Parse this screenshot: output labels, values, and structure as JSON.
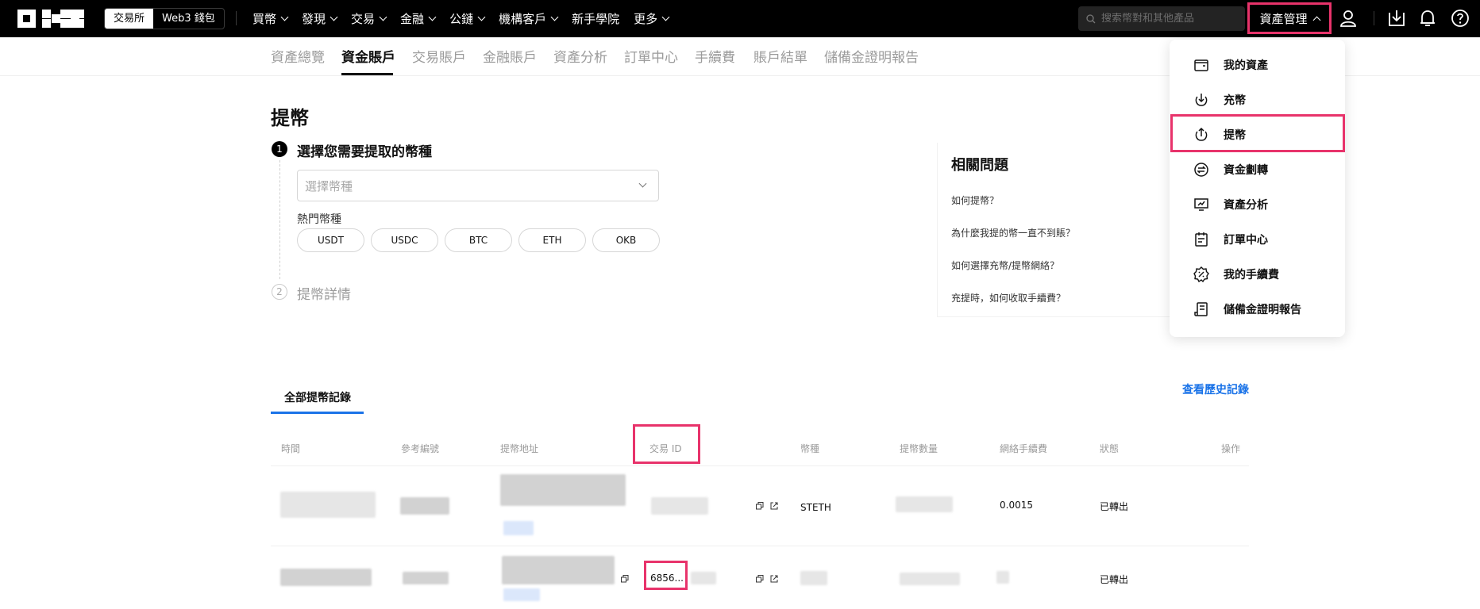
{
  "topnav": {
    "segments": [
      "交易所",
      "Web3 錢包"
    ],
    "menu": [
      "買幣",
      "發現",
      "交易",
      "金融",
      "公鏈",
      "機構客戶",
      "新手學院",
      "更多"
    ],
    "menu_has_chevron": [
      true,
      true,
      true,
      true,
      true,
      true,
      false,
      true
    ],
    "search_placeholder": "搜索幣對和其他產品",
    "asset_button": "資產管理",
    "icons": [
      "user-icon",
      "download-icon",
      "bell-icon",
      "help-icon"
    ]
  },
  "subnav": {
    "tabs": [
      "資產總覽",
      "資金賬戶",
      "交易賬戶",
      "金融賬戶",
      "資產分析",
      "訂單中心",
      "手續費",
      "賬戶結單",
      "儲備金證明報告"
    ],
    "active_index": 1
  },
  "page_title": "提幣",
  "steps": {
    "step1": {
      "num": "1",
      "title": "選擇您需要提取的幣種"
    },
    "step2": {
      "num": "2",
      "title": "提幣詳情"
    }
  },
  "coin_select": {
    "placeholder": "選擇幣種"
  },
  "hot_coins": {
    "label": "熱門幣種",
    "coins": [
      "USDT",
      "USDC",
      "BTC",
      "ETH",
      "OKB"
    ]
  },
  "faq": {
    "title": "相關問題",
    "items": [
      "如何提幣？",
      "為什麼我提的幣一直不到賬？",
      "如何選擇充幣/提幣網絡？",
      "充提時，如何收取手續費？"
    ]
  },
  "dropdown": {
    "items": [
      {
        "label": "我的資產",
        "icon": "wallet-icon"
      },
      {
        "label": "充幣",
        "icon": "deposit-icon"
      },
      {
        "label": "提幣",
        "icon": "withdraw-icon"
      },
      {
        "label": "資金劃轉",
        "icon": "transfer-icon"
      },
      {
        "label": "資產分析",
        "icon": "analysis-icon"
      },
      {
        "label": "訂單中心",
        "icon": "order-icon"
      },
      {
        "label": "我的手續費",
        "icon": "fee-icon"
      },
      {
        "label": "儲備金證明報告",
        "icon": "report-icon"
      }
    ]
  },
  "history": {
    "tab": "全部提幣記錄",
    "view_link": "查看歷史記錄",
    "columns": [
      "時間",
      "參考編號",
      "提幣地址",
      "交易 ID",
      "幣種",
      "提幣數量",
      "網絡手續費",
      "狀態",
      "操作"
    ],
    "rows": [
      {
        "coin": "STETH",
        "fee": "0.0015",
        "status": "已轉出",
        "txid": ""
      },
      {
        "coin": "",
        "fee": "",
        "status": "已轉出",
        "txid": "6856..."
      }
    ]
  },
  "colors": {
    "highlight": "#e8336b",
    "link": "#1a73e8",
    "nav_bg": "#000000"
  }
}
